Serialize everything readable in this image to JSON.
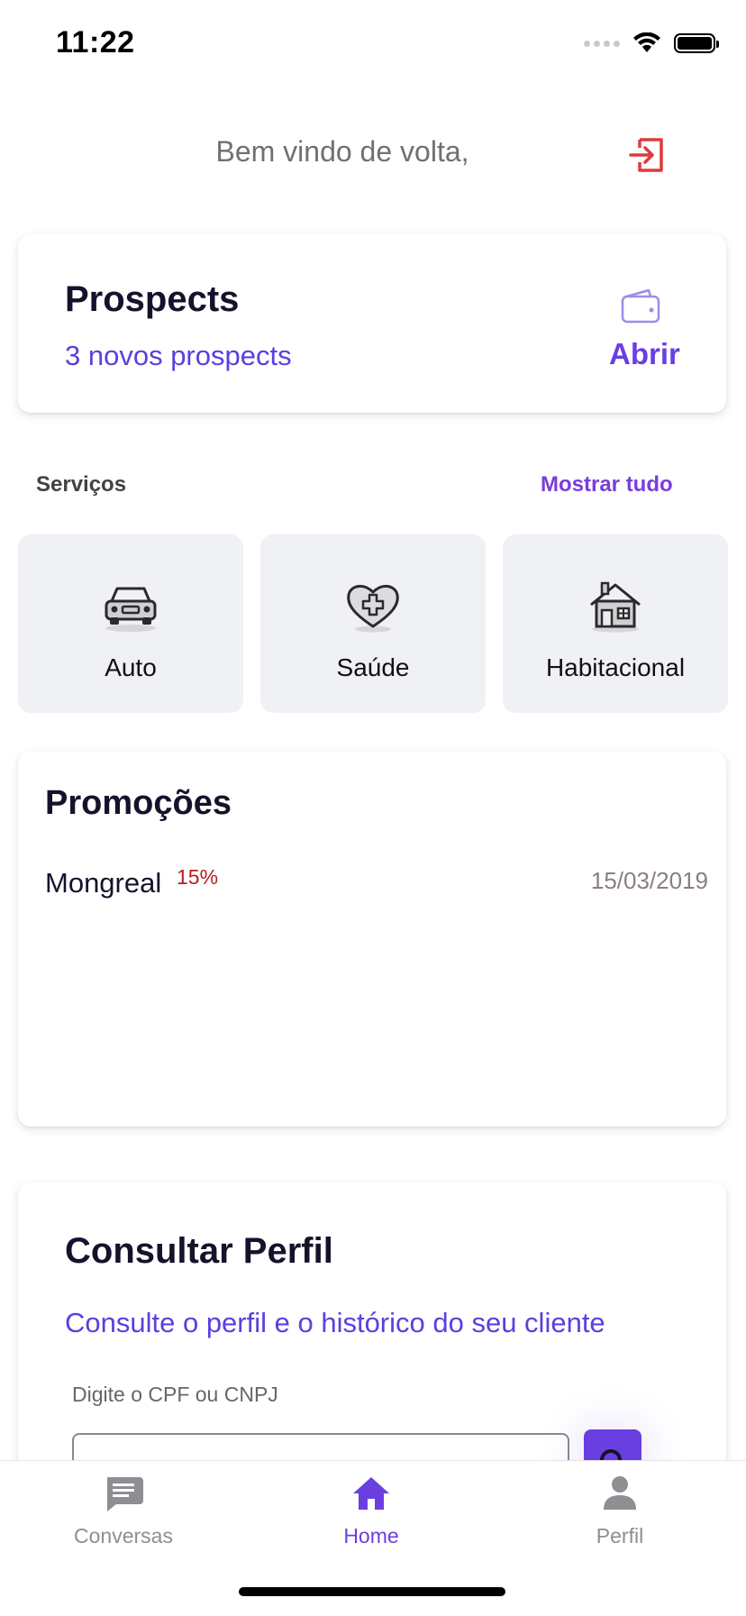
{
  "status_bar": {
    "time": "11:22"
  },
  "header": {
    "welcome": "Bem vindo de volta,",
    "logout_icon": "logout-icon"
  },
  "prospects_card": {
    "title": "Prospects",
    "subtitle": "3 novos prospects",
    "action_label": "Abrir",
    "icon": "wallet-icon"
  },
  "services": {
    "label": "Serviços",
    "show_all": "Mostrar tudo",
    "items": [
      {
        "label": "Auto",
        "icon": "car-icon"
      },
      {
        "label": "Saúde",
        "icon": "heart-plus-icon"
      },
      {
        "label": "Habitacional",
        "icon": "house-icon"
      }
    ]
  },
  "promotions": {
    "title": "Promoções",
    "items": [
      {
        "name": "Mongreal",
        "discount": "15%",
        "date": "15/03/2019"
      }
    ]
  },
  "consult_profile": {
    "title": "Consultar Perfil",
    "subtitle": "Consulte o perfil e o histórico do seu cliente",
    "input_label": "Digite o CPF ou CNPJ",
    "input_value": "",
    "search_icon": "search-icon"
  },
  "tab_bar": {
    "tabs": [
      {
        "label": "Conversas",
        "icon": "chat-icon",
        "active": false
      },
      {
        "label": "Home",
        "icon": "home-icon",
        "active": true
      },
      {
        "label": "Perfil",
        "icon": "person-icon",
        "active": false
      }
    ]
  },
  "colors": {
    "accent": "#6a3fe0",
    "accent_text": "#5b3fe0",
    "danger": "#e03a3a",
    "discount": "#b22222",
    "tab_inactive": "#8e8e93"
  }
}
